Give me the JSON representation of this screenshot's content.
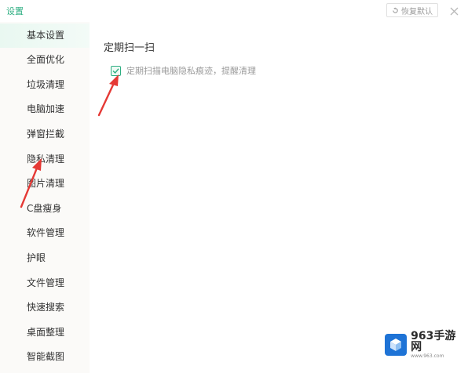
{
  "window": {
    "title": "设置",
    "restore_label": "恢复默认",
    "close_glyph": "✕",
    "accent_color": "#2eae82"
  },
  "sidebar": {
    "items": [
      {
        "label": "基本设置",
        "active": true
      },
      {
        "label": "全面优化",
        "active": false
      },
      {
        "label": "垃圾清理",
        "active": false
      },
      {
        "label": "电脑加速",
        "active": false
      },
      {
        "label": "弹窗拦截",
        "active": false
      },
      {
        "label": "隐私清理",
        "active": false
      },
      {
        "label": "图片清理",
        "active": false
      },
      {
        "label": "C盘瘦身",
        "active": false
      },
      {
        "label": "软件管理",
        "active": false
      },
      {
        "label": "护眼",
        "active": false
      },
      {
        "label": "文件管理",
        "active": false
      },
      {
        "label": "快速搜索",
        "active": false
      },
      {
        "label": "桌面整理",
        "active": false
      },
      {
        "label": "智能截图",
        "active": false
      }
    ]
  },
  "main": {
    "section_title": "定期扫一扫",
    "option": {
      "label": "定期扫描电脑隐私痕迹，提醒清理",
      "checked": true
    }
  },
  "watermark": {
    "brand": "963手游网",
    "url": "www.963.com"
  },
  "annotation_color": "#e53935"
}
